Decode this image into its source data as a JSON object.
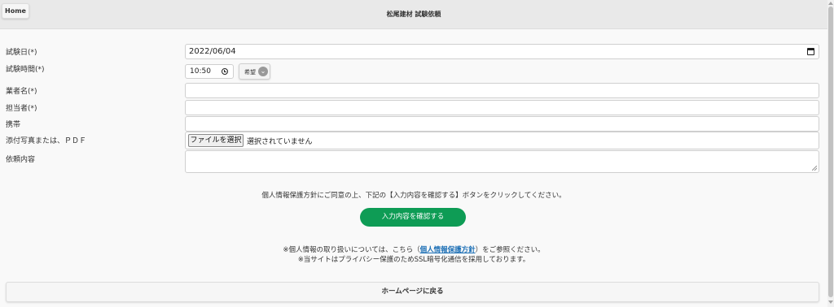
{
  "header": {
    "home_label": "Home",
    "title": "松尾建材 試験依頼"
  },
  "form": {
    "date_label": "試験日(*)",
    "date_value": "2022/06/04",
    "time_label": "試験時間(*)",
    "time_value": "10:50",
    "time_preference": "希望",
    "company_label": "業者名(*)",
    "company_value": "",
    "contact_label": "担当者(*)",
    "contact_value": "",
    "mobile_label": "携帯",
    "mobile_value": "",
    "attachment_label": "添付写真または、ＰＤＦ",
    "file_button": "ファイルを選択",
    "file_status": "選択されていません",
    "request_label": "依頼内容",
    "request_value": ""
  },
  "notice": "個人情報保護方針にご同意の上、下記の【入力内容を確認する】ボタンをクリックしてください。",
  "confirm_button": "入力内容を確認する",
  "privacy": {
    "prefix": "※個人情報の取り扱いについては、こちら（",
    "link": "個人情報保護方針",
    "suffix": "）をご参照ください。",
    "ssl": "※当サイトはプライバシー保護のためSSL暗号化通信を採用しております。"
  },
  "back_button": "ホームページに戻る",
  "icons": {
    "calendar": "calendar-icon",
    "clock": "clock-icon",
    "chevron": "chevron-down-icon"
  },
  "colors": {
    "confirm_button": "#0e9c55",
    "link": "#1c6fb5"
  }
}
